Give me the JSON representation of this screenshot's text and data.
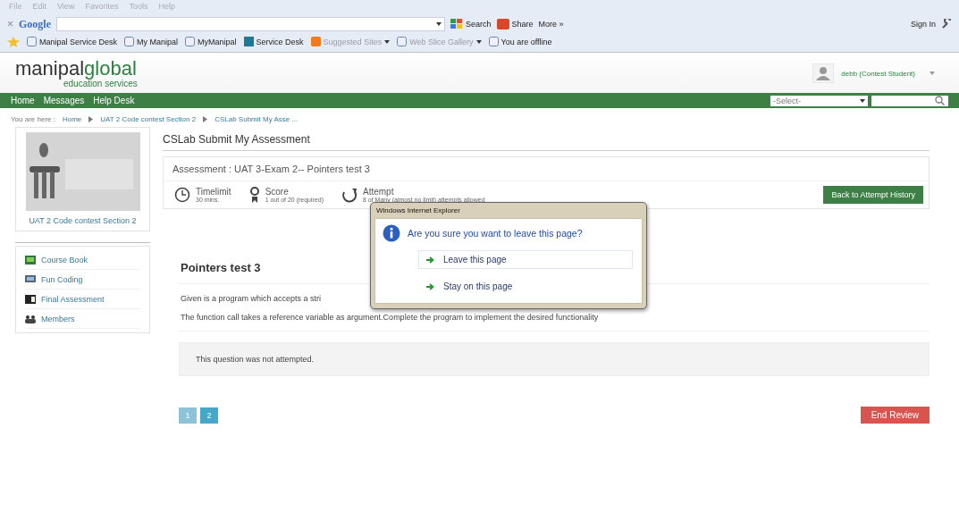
{
  "browser": {
    "menu": [
      "File",
      "Edit",
      "View",
      "Favorites",
      "Tools",
      "Help"
    ],
    "toolbar": {
      "close": "×",
      "brand": "Google",
      "search": "Search",
      "share": "Share",
      "more": "More »",
      "sign_in": "Sign In"
    },
    "favorites": [
      {
        "label": "Manipal Service Desk",
        "kind": "page",
        "disabled": false
      },
      {
        "label": "My Manipal",
        "kind": "page",
        "disabled": false
      },
      {
        "label": "MyManipal",
        "kind": "page",
        "disabled": false
      },
      {
        "label": "Service Desk",
        "kind": "tile",
        "disabled": false
      },
      {
        "label": "Suggested Sites",
        "kind": "orange",
        "disabled": true
      },
      {
        "label": "Web Slice Gallery",
        "kind": "page",
        "disabled": true
      },
      {
        "label": "You are offline",
        "kind": "page",
        "disabled": false
      }
    ]
  },
  "header": {
    "logo_main": "manipal",
    "logo_accent": "global",
    "logo_sub": "education services",
    "user": "debb (Contest Student)"
  },
  "nav": {
    "items": [
      "Home",
      "Messages",
      "Help Desk"
    ],
    "select": "-Select-"
  },
  "breadcrumb": {
    "lead": "You are here :",
    "items": [
      "Home",
      "UAT 2 Code contest Section 2",
      "CSLab Submit My Asse ..."
    ]
  },
  "sidebar": {
    "caption": "UAT 2 Code contest Section 2",
    "items": [
      {
        "label": "Course Book",
        "kind": "book"
      },
      {
        "label": "Fun Coding",
        "kind": "code"
      },
      {
        "label": "Final Assessment",
        "kind": "exam"
      },
      {
        "label": "Members",
        "kind": "people"
      }
    ]
  },
  "page_title": "CSLab Submit My Assessment",
  "assessment": {
    "title": "Assessment : UAT 3-Exam 2-- Pointers test 3",
    "stats": [
      {
        "kind": "clock",
        "label": "Timelimit",
        "detail": "30 mins."
      },
      {
        "kind": "award",
        "label": "Score",
        "detail": "1 out of 20 (required)"
      },
      {
        "kind": "refresh",
        "label": "Attempt",
        "detail": "8 of Many (almost no limit) attempts allowed"
      }
    ],
    "back_button": "Back to Attempt History"
  },
  "question": {
    "title": "Pointers test 3",
    "paragraphs": [
      "Given is a program which accepts a stri",
      "The function call takes a reference variable as argument.Complete the program to implement the desired functionality"
    ],
    "notice": "This question was not attempted."
  },
  "pagination": [
    {
      "label": "1",
      "selected": false
    },
    {
      "label": "2",
      "selected": true
    }
  ],
  "end_button": "End Review",
  "dialog": {
    "title": "Windows Internet Explorer",
    "question": "Are you sure you want to leave this page?",
    "options": [
      {
        "label": "Leave this page",
        "selected": true
      },
      {
        "label": "Stay on this page",
        "selected": false
      }
    ]
  }
}
